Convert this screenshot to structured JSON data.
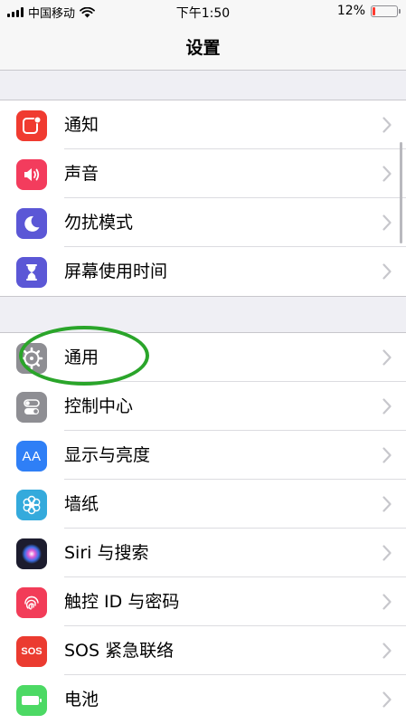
{
  "status_bar": {
    "carrier": "中国移动",
    "time": "下午1:50",
    "battery_percent": "12%",
    "battery_level": 0.12
  },
  "nav": {
    "title": "设置"
  },
  "groups": [
    {
      "items": [
        {
          "label": "通知",
          "icon": "notifications-icon",
          "color": "#f03b30"
        },
        {
          "label": "声音",
          "icon": "sounds-icon",
          "color": "#f33c5d"
        },
        {
          "label": "勿扰模式",
          "icon": "moon-icon",
          "color": "#5b57d6"
        },
        {
          "label": "屏幕使用时间",
          "icon": "hourglass-icon",
          "color": "#5b57d6"
        }
      ]
    },
    {
      "items": [
        {
          "label": "通用",
          "icon": "gear-icon",
          "color": "#8e8e93"
        },
        {
          "label": "控制中心",
          "icon": "toggles-icon",
          "color": "#8e8e93"
        },
        {
          "label": "显示与亮度",
          "icon": "aa-icon",
          "color": "#2f7ff6",
          "icon_text": "AA"
        },
        {
          "label": "墙纸",
          "icon": "flower-icon",
          "color": "#34aadc"
        },
        {
          "label": "Siri 与搜索",
          "icon": "siri-icon",
          "color": "#1c1c2e"
        },
        {
          "label": "触控 ID 与密码",
          "icon": "fingerprint-icon",
          "color": "#f23c58"
        },
        {
          "label": "SOS 紧急联络",
          "icon": "sos-icon",
          "color": "#eb3b30",
          "icon_text": "SOS"
        },
        {
          "label": "电池",
          "icon": "battery-icon",
          "color": "#4cd964"
        }
      ]
    }
  ],
  "annotation": {
    "color": "#2aa52a",
    "target": "通用"
  }
}
